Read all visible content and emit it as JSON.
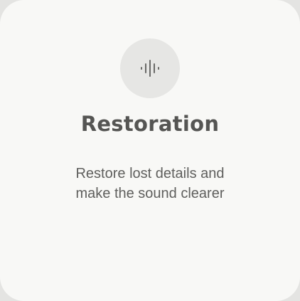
{
  "card": {
    "icon": "sound-wave-icon",
    "title": "Restoration",
    "description": "Restore lost details and make the sound clearer"
  },
  "colors": {
    "background": "#e4e4e2",
    "card": "#f8f8f6",
    "icon_circle": "#e6e6e4",
    "icon": "#6a6a68",
    "title": "#555553",
    "text": "#5f5f5d"
  }
}
